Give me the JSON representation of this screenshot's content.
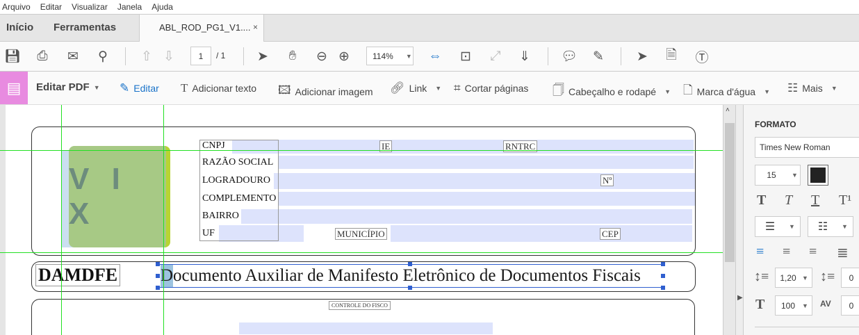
{
  "menu": [
    "Arquivo",
    "Editar",
    "Visualizar",
    "Janela",
    "Ajuda"
  ],
  "tabs": {
    "home": "Início",
    "tools": "Ferramentas",
    "document": "ABL_ROD_PG1_V1....",
    "close": "×"
  },
  "toolbar": {
    "page_current": "1",
    "page_total": "/ 1",
    "zoom": "114%"
  },
  "edit_toolbar": {
    "title": "Editar PDF",
    "items": [
      "Editar",
      "Adicionar texto",
      "Adicionar imagem",
      "Link",
      "Cortar páginas",
      "Cabeçalho e rodapé",
      "Marca d'água",
      "Mais"
    ]
  },
  "document": {
    "logo": "V I X",
    "labels": {
      "cnpj": "CNPJ",
      "ie": "IE",
      "rntrc": "RNTRC",
      "razao": "RAZÃO SOCIAL",
      "logradouro": "LOGRADOURO",
      "numero": "Nº",
      "complemento": "COMPLEMENTO",
      "bairro": "BAIRRO",
      "uf": "UF",
      "municipio": "MUNICÍPIO",
      "cep": "CEP"
    },
    "damdfe": "DAMDFE",
    "heading": "Documento Auxiliar de Manifesto Eletrônico de Documentos Fiscais",
    "controle": "CONTROLE DO FISCO"
  },
  "panel": {
    "section": "FORMATO",
    "font": "Times New Roman",
    "font_size": "15",
    "text_color": "#222222",
    "line_spacing": "1,20",
    "paragraph_spacing": "0",
    "horizontal_scale": "100",
    "char_spacing": "0"
  },
  "colors": {
    "accent": "#1a73c9",
    "edit_block": "#e88be0",
    "guide": "#22e022",
    "field": "#dde3fc"
  }
}
